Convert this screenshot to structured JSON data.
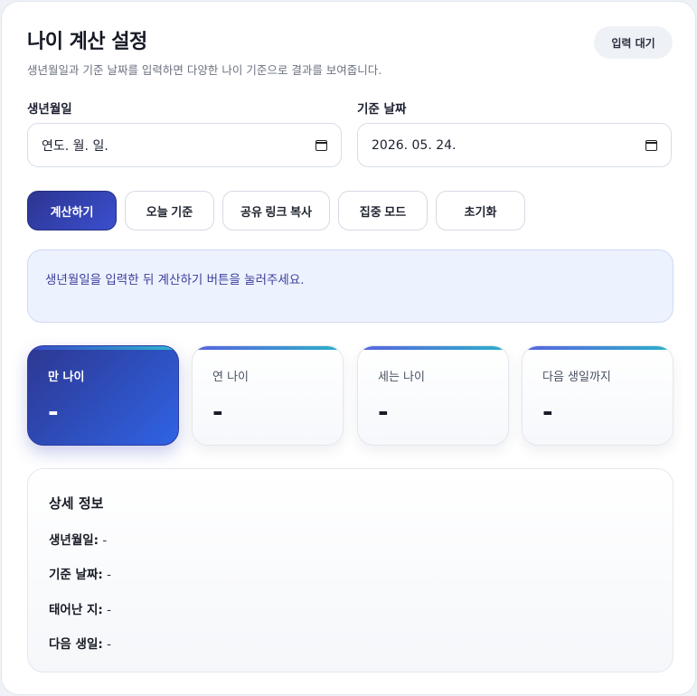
{
  "header": {
    "title": "나이 계산 설정",
    "subtitle": "생년월일과 기준 날짜를 입력하면 다양한 나이 기준으로 결과를 보여줍니다.",
    "status": "입력 대기"
  },
  "form": {
    "birth_label": "생년월일",
    "birth_value": "연도. 월. 일.",
    "ref_label": "기준 날짜",
    "ref_value": "2026. 05. 24."
  },
  "actions": {
    "calculate": "계산하기",
    "today": "오늘 기준",
    "share": "공유 링크 복사",
    "focus": "집중 모드",
    "reset": "초기화"
  },
  "notice": "생년월일을 입력한 뒤 계산하기 버튼을 눌러주세요.",
  "cards": [
    {
      "label": "만 나이",
      "value": "-"
    },
    {
      "label": "연 나이",
      "value": "-"
    },
    {
      "label": "세는 나이",
      "value": "-"
    },
    {
      "label": "다음 생일까지",
      "value": "-"
    }
  ],
  "details": {
    "title": "상세 정보",
    "rows": [
      {
        "label": "생년월일:",
        "value": "-"
      },
      {
        "label": "기준 날짜:",
        "value": "-"
      },
      {
        "label": "태어난 지:",
        "value": "-"
      },
      {
        "label": "다음 생일:",
        "value": "-"
      }
    ]
  },
  "colors": {
    "primary": "#2c3590",
    "accent_gradient_end": "#2bb0c9",
    "notice_bg": "#edf2ff",
    "notice_text": "#3a3f9c"
  },
  "icons": {
    "date_picker": "calendar-icon"
  }
}
